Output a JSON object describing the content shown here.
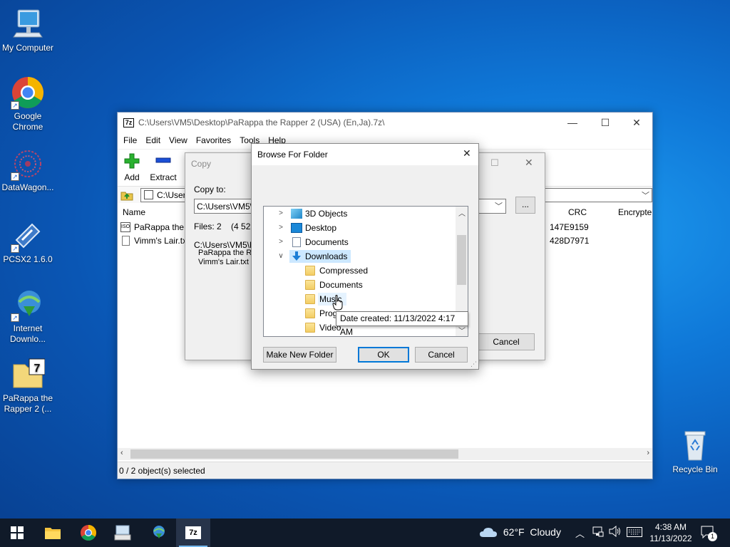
{
  "desktop": {
    "icons": [
      {
        "label": "My Computer"
      },
      {
        "label": "Google Chrome"
      },
      {
        "label": "DataWagon..."
      },
      {
        "label": "PCSX2 1.6.0"
      },
      {
        "label": "Internet Downlo..."
      },
      {
        "label": "PaRappa the Rapper 2 (..."
      },
      {
        "label": "Recycle Bin"
      }
    ]
  },
  "main_window": {
    "title": "C:\\Users\\VM5\\Desktop\\PaRappa the Rapper 2 (USA) (En,Ja).7z\\",
    "icon_label": "7z",
    "menu": [
      "File",
      "Edit",
      "View",
      "Favorites",
      "Tools",
      "Help"
    ],
    "toolbar": {
      "add_label": "Add",
      "extract_label": "Extract"
    },
    "address_value": "C:\\Users",
    "columns": {
      "name": "Name",
      "crc": "CRC",
      "encrypted": "Encrypte"
    },
    "rows": [
      {
        "name": "PaRappa the R",
        "crc": "147E9159"
      },
      {
        "name": "Vimm's Lair.tx",
        "crc": "428D7971"
      }
    ],
    "status": "0 / 2 object(s) selected"
  },
  "copy_dialog": {
    "title": "Copy",
    "copy_to_label": "Copy to:",
    "path_value": "C:\\Users\\VM5\\D",
    "browse_label": "...",
    "files_info": "Files: 2    (4 522",
    "source_path": "C:\\Users\\VM5\\D",
    "file1": "PaRappa the R",
    "file2": "Vimm's Lair.txt",
    "cancel_label": "Cancel"
  },
  "browse_dialog": {
    "title": "Browse For Folder",
    "tree": [
      {
        "label": "3D Objects"
      },
      {
        "label": "Desktop"
      },
      {
        "label": "Documents"
      },
      {
        "label": "Downloads"
      },
      {
        "label": "Compressed"
      },
      {
        "label": "Documents"
      },
      {
        "label": "Music"
      },
      {
        "label": "Programs"
      },
      {
        "label": "Video"
      }
    ],
    "tooltip": "Date created: 11/13/2022 4:17 AM",
    "new_folder_label": "Make New Folder",
    "ok_label": "OK",
    "cancel_label": "Cancel"
  },
  "taskbar": {
    "weather": "62°F  Cloudy",
    "time": "4:38 AM",
    "date": "11/13/2022",
    "notification_count": "1",
    "app_7z_label": "7z"
  }
}
